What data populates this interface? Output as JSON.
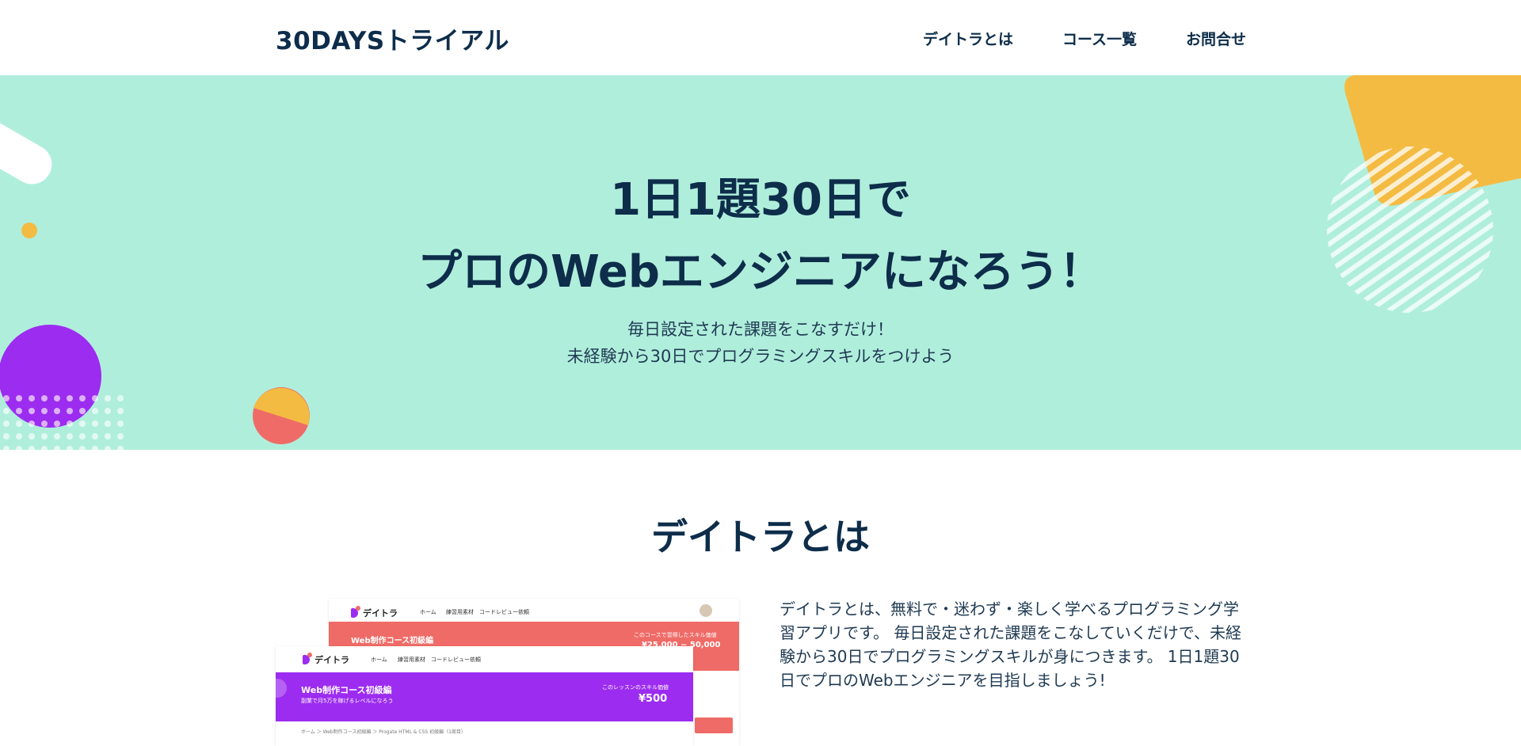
{
  "header": {
    "logo": "30DAYSトライアル",
    "nav": [
      "デイトラとは",
      "コース一覧",
      "お問合せ"
    ]
  },
  "hero": {
    "title_line1": "1日1題30日で",
    "title_line2": "プロのWebエンジニアになろう！",
    "sub_line1": "毎日設定された課題をこなすだけ！",
    "sub_line2": "未経験から30日でプログラミングスキルをつけよう"
  },
  "about": {
    "title": "デイトラとは",
    "description": "デイトラとは、無料で・迷わず・楽しく学べるプログラミング学習アプリです。 毎日設定された課題をこなしていくだけで、未経験から30日でプログラミングスキルが身につきます。 1日1題30日でプロのWebエンジニアを目指しましょう!"
  },
  "screenshot_back": {
    "logo": "デイトラ",
    "nav": [
      "ホーム",
      "練習用素材",
      "コードレビュー依頼"
    ],
    "banner_title": "Web制作コース初級編",
    "skill_label": "このコースで習得したスキル価値",
    "price": "¥25,000 ~ 50,000"
  },
  "screenshot_front": {
    "logo": "デイトラ",
    "nav": [
      "ホーム",
      "練習用素材",
      "コードレビュー依頼"
    ],
    "banner_title": "Web制作コース初級編",
    "banner_sub": "副業で月5万を稼げるレベルになろう",
    "skill_label": "このレッスンのスキル価値",
    "price": "¥500",
    "breadcrumb": "ホーム ＞ Web制作コース初級編 ＞ Progate HTML & CSS 初級編（1周目）"
  },
  "colors": {
    "navy": "#0d2d4a",
    "hero_bg": "#b0eedc",
    "purple": "#9c2cf0",
    "orange": "#f4bb42",
    "coral": "#ef6b67"
  }
}
